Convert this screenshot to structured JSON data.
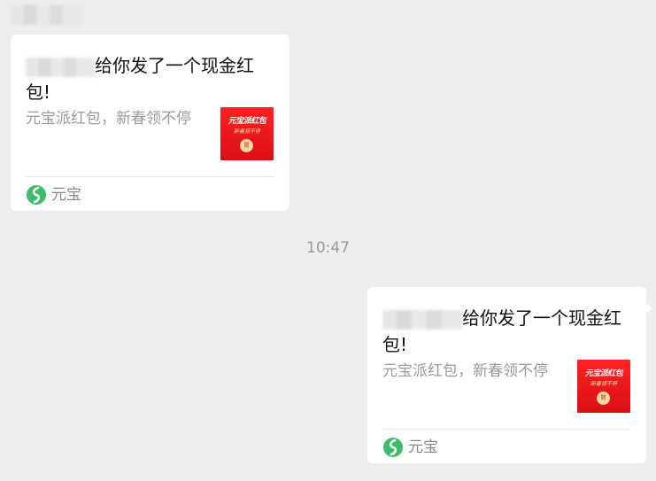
{
  "messages": [
    {
      "title_suffix": "给你发了一个现金红包!",
      "description": "元宝派红包，新春领不停",
      "thumb_title": "元宝派红包",
      "thumb_subtitle": "新春领不停",
      "thumb_button": "開",
      "brand": "元宝"
    },
    {
      "title_suffix": "给你发了一个现金红包!",
      "description": "元宝派红包，新春领不停",
      "thumb_title": "元宝派红包",
      "thumb_subtitle": "新春领不停",
      "thumb_button": "開",
      "brand": "元宝"
    }
  ],
  "timestamp": "10:47",
  "colors": {
    "background": "#ededed",
    "card": "#ffffff",
    "envelope_red": "#e8161b",
    "brand_green": "#3dbd6b"
  }
}
